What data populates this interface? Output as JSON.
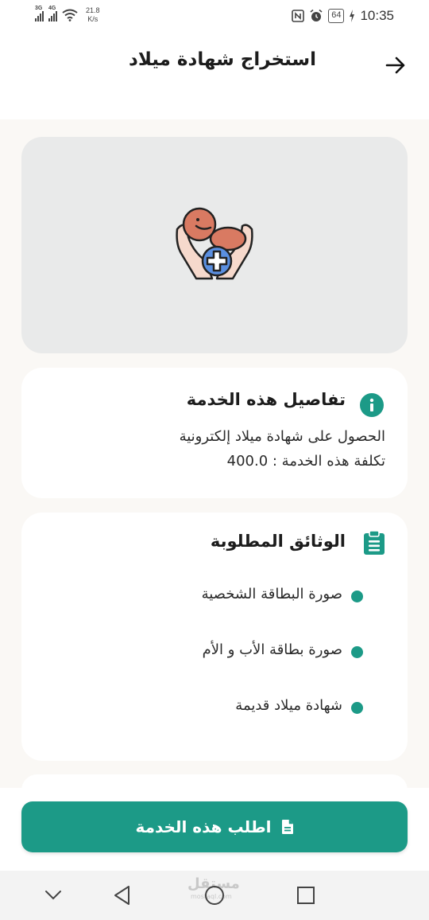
{
  "status_bar": {
    "network_1": "3G",
    "network_2": "4G",
    "speed_value": "21.8",
    "speed_unit": "K/s",
    "battery": "64",
    "time": "10:35"
  },
  "header": {
    "title": "استخراج شهادة ميلاد"
  },
  "details": {
    "title": "تفاصيل هذه الخدمة",
    "description": "الحصول على شهادة ميلاد إلكترونية",
    "cost": "تكلفة هذه الخدمة : 400.0"
  },
  "documents": {
    "title": "الوثائق المطلوبة",
    "items": [
      "صورة البطاقة الشخصية",
      "صورة بطاقة الأب و الأم",
      "شهادة ميلاد قديمة"
    ]
  },
  "cta": {
    "label": "اطلب هذه الخدمة"
  },
  "watermark": {
    "text": "مستقل",
    "sub": "mostaql.com"
  },
  "colors": {
    "accent": "#1c9a87",
    "background": "#faf8f5",
    "hero_bg": "#e9eaea"
  },
  "icons": {
    "back": "arrow-right-icon",
    "hero": "baby-hands-plus-icon",
    "info": "info-icon",
    "documents": "clipboard-icon",
    "cta": "document-icon"
  }
}
